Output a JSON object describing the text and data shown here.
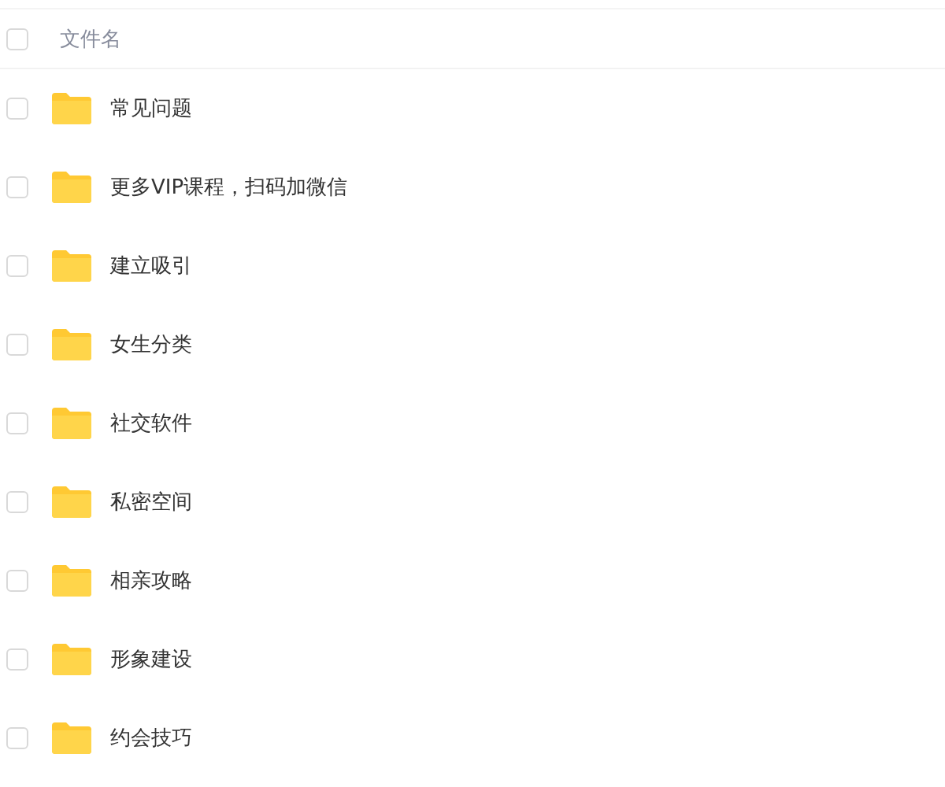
{
  "header": {
    "checked": false,
    "column": "文件名"
  },
  "files": [
    {
      "name": "常见问题",
      "checked": false
    },
    {
      "name": "更多VIP课程，扫码加微信",
      "checked": false
    },
    {
      "name": "建立吸引",
      "checked": false
    },
    {
      "name": "女生分类",
      "checked": false
    },
    {
      "name": "社交软件",
      "checked": false
    },
    {
      "name": "私密空间",
      "checked": false
    },
    {
      "name": "相亲攻略",
      "checked": false
    },
    {
      "name": "形象建设",
      "checked": false
    },
    {
      "name": "约会技巧",
      "checked": false
    }
  ]
}
